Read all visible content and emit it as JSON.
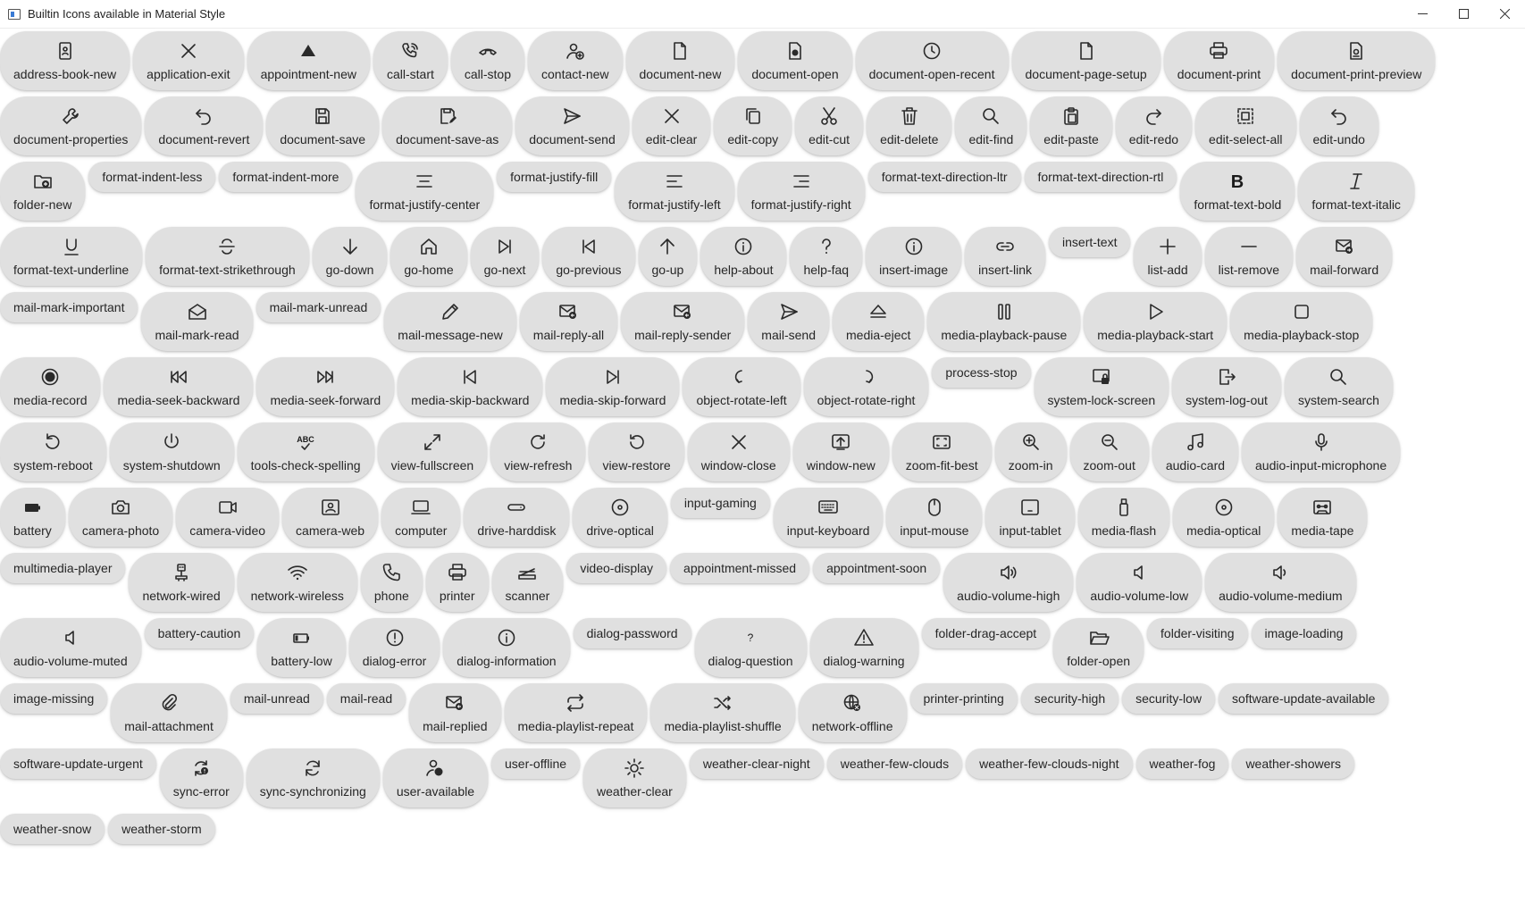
{
  "window": {
    "title": "Builtin Icons available in Material Style"
  },
  "rows": [
    [
      {
        "label": "address-book-new",
        "icon": "address-book-icon"
      },
      {
        "label": "application-exit",
        "icon": "close-icon"
      },
      {
        "label": "appointment-new",
        "icon": "triangle-icon"
      },
      {
        "label": "call-start",
        "icon": "phone-ring-icon"
      },
      {
        "label": "call-stop",
        "icon": "phone-hangup-icon"
      },
      {
        "label": "contact-new",
        "icon": "person-add-icon"
      },
      {
        "label": "document-new",
        "icon": "document-icon"
      },
      {
        "label": "document-open",
        "icon": "document-open-icon"
      },
      {
        "label": "document-open-recent",
        "icon": "clock-icon"
      },
      {
        "label": "document-page-setup",
        "icon": "document-icon"
      },
      {
        "label": "document-print",
        "icon": "printer-icon"
      },
      {
        "label": "document-print-preview",
        "icon": "document-preview-icon"
      }
    ],
    [
      {
        "label": "document-properties",
        "icon": "wrench-icon"
      },
      {
        "label": "document-revert",
        "icon": "undo-icon"
      },
      {
        "label": "document-save",
        "icon": "save-icon"
      },
      {
        "label": "document-save-as",
        "icon": "save-as-icon"
      },
      {
        "label": "document-send",
        "icon": "send-icon"
      },
      {
        "label": "edit-clear",
        "icon": "close-icon"
      },
      {
        "label": "edit-copy",
        "icon": "copy-icon"
      },
      {
        "label": "edit-cut",
        "icon": "scissors-icon"
      },
      {
        "label": "edit-delete",
        "icon": "trash-icon"
      },
      {
        "label": "edit-find",
        "icon": "search-icon"
      },
      {
        "label": "edit-paste",
        "icon": "clipboard-icon"
      },
      {
        "label": "edit-redo",
        "icon": "redo-icon"
      },
      {
        "label": "edit-select-all",
        "icon": "select-all-icon"
      },
      {
        "label": "edit-undo",
        "icon": "undo-icon"
      }
    ],
    [
      {
        "label": "folder-new",
        "icon": "folder-add-icon"
      },
      {
        "label": "format-indent-less",
        "icon": ""
      },
      {
        "label": "format-indent-more",
        "icon": ""
      },
      {
        "label": "format-justify-center",
        "icon": "align-center-icon"
      },
      {
        "label": "format-justify-fill",
        "icon": ""
      },
      {
        "label": "format-justify-left",
        "icon": "align-left-icon"
      },
      {
        "label": "format-justify-right",
        "icon": "align-right-icon"
      },
      {
        "label": "format-text-direction-ltr",
        "icon": ""
      },
      {
        "label": "format-text-direction-rtl",
        "icon": ""
      },
      {
        "label": "format-text-bold",
        "icon": "bold-icon"
      },
      {
        "label": "format-text-italic",
        "icon": "italic-icon"
      }
    ],
    [
      {
        "label": "format-text-underline",
        "icon": "underline-icon"
      },
      {
        "label": "format-text-strikethrough",
        "icon": "strikethrough-icon"
      },
      {
        "label": "go-down",
        "icon": "arrow-down-icon"
      },
      {
        "label": "go-home",
        "icon": "home-icon"
      },
      {
        "label": "go-next",
        "icon": "skip-next-icon"
      },
      {
        "label": "go-previous",
        "icon": "skip-previous-icon"
      },
      {
        "label": "go-up",
        "icon": "arrow-up-icon"
      },
      {
        "label": "help-about",
        "icon": "info-icon"
      },
      {
        "label": "help-faq",
        "icon": "question-icon"
      },
      {
        "label": "insert-image",
        "icon": "info-icon"
      },
      {
        "label": "insert-link",
        "icon": "link-icon"
      },
      {
        "label": "insert-text",
        "icon": ""
      },
      {
        "label": "list-add",
        "icon": "plus-icon"
      },
      {
        "label": "list-remove",
        "icon": "minus-icon"
      },
      {
        "label": "mail-forward",
        "icon": "mail-forward-icon"
      }
    ],
    [
      {
        "label": "mail-mark-important",
        "icon": ""
      },
      {
        "label": "mail-mark-read",
        "icon": "mail-open-icon"
      },
      {
        "label": "mail-mark-unread",
        "icon": ""
      },
      {
        "label": "mail-message-new",
        "icon": "pencil-icon"
      },
      {
        "label": "mail-reply-all",
        "icon": "mail-reply-icon"
      },
      {
        "label": "mail-reply-sender",
        "icon": "mail-reply-icon"
      },
      {
        "label": "mail-send",
        "icon": "send-icon"
      },
      {
        "label": "media-eject",
        "icon": "eject-icon"
      },
      {
        "label": "media-playback-pause",
        "icon": "pause-icon"
      },
      {
        "label": "media-playback-start",
        "icon": "play-icon"
      },
      {
        "label": "media-playback-stop",
        "icon": "stop-icon"
      }
    ],
    [
      {
        "label": "media-record",
        "icon": "record-icon"
      },
      {
        "label": "media-seek-backward",
        "icon": "rewind-icon"
      },
      {
        "label": "media-seek-forward",
        "icon": "fast-forward-icon"
      },
      {
        "label": "media-skip-backward",
        "icon": "skip-previous-icon"
      },
      {
        "label": "media-skip-forward",
        "icon": "skip-next-icon"
      },
      {
        "label": "object-rotate-left",
        "icon": "rotate-left-icon"
      },
      {
        "label": "object-rotate-right",
        "icon": "rotate-right-icon"
      },
      {
        "label": "process-stop",
        "icon": ""
      },
      {
        "label": "system-lock-screen",
        "icon": "lock-screen-icon"
      },
      {
        "label": "system-log-out",
        "icon": "logout-icon"
      },
      {
        "label": "system-search",
        "icon": "search-icon"
      }
    ],
    [
      {
        "label": "system-reboot",
        "icon": "reboot-icon"
      },
      {
        "label": "system-shutdown",
        "icon": "power-icon"
      },
      {
        "label": "tools-check-spelling",
        "icon": "spellcheck-icon"
      },
      {
        "label": "view-fullscreen",
        "icon": "fullscreen-icon"
      },
      {
        "label": "view-refresh",
        "icon": "refresh-icon"
      },
      {
        "label": "view-restore",
        "icon": "restore-icon"
      },
      {
        "label": "window-close",
        "icon": "close-icon"
      },
      {
        "label": "window-new",
        "icon": "window-new-icon"
      },
      {
        "label": "zoom-fit-best",
        "icon": "fit-screen-icon"
      },
      {
        "label": "zoom-in",
        "icon": "zoom-in-icon"
      },
      {
        "label": "zoom-out",
        "icon": "zoom-out-icon"
      },
      {
        "label": "audio-card",
        "icon": "music-note-icon"
      },
      {
        "label": "audio-input-microphone",
        "icon": "microphone-icon"
      }
    ],
    [
      {
        "label": "battery",
        "icon": "battery-icon"
      },
      {
        "label": "camera-photo",
        "icon": "camera-icon"
      },
      {
        "label": "camera-video",
        "icon": "video-camera-icon"
      },
      {
        "label": "camera-web",
        "icon": "webcam-icon"
      },
      {
        "label": "computer",
        "icon": "computer-icon"
      },
      {
        "label": "drive-harddisk",
        "icon": "harddisk-icon"
      },
      {
        "label": "drive-optical",
        "icon": "disc-icon"
      },
      {
        "label": "input-gaming",
        "icon": ""
      },
      {
        "label": "input-keyboard",
        "icon": "keyboard-icon"
      },
      {
        "label": "input-mouse",
        "icon": "mouse-icon"
      },
      {
        "label": "input-tablet",
        "icon": "tablet-icon"
      },
      {
        "label": "media-flash",
        "icon": "usb-stick-icon"
      },
      {
        "label": "media-optical",
        "icon": "disc-icon"
      },
      {
        "label": "media-tape",
        "icon": "tape-icon"
      }
    ],
    [
      {
        "label": "multimedia-player",
        "icon": ""
      },
      {
        "label": "network-wired",
        "icon": "ethernet-icon"
      },
      {
        "label": "network-wireless",
        "icon": "wifi-icon"
      },
      {
        "label": "phone",
        "icon": "phone-icon"
      },
      {
        "label": "printer",
        "icon": "printer-icon"
      },
      {
        "label": "scanner",
        "icon": "scanner-icon"
      },
      {
        "label": "video-display",
        "icon": ""
      },
      {
        "label": "appointment-missed",
        "icon": ""
      },
      {
        "label": "appointment-soon",
        "icon": ""
      },
      {
        "label": "audio-volume-high",
        "icon": "volume-high-icon"
      },
      {
        "label": "audio-volume-low",
        "icon": "volume-low-icon"
      },
      {
        "label": "audio-volume-medium",
        "icon": "volume-medium-icon"
      }
    ],
    [
      {
        "label": "audio-volume-muted",
        "icon": "volume-muted-icon"
      },
      {
        "label": "battery-caution",
        "icon": ""
      },
      {
        "label": "battery-low",
        "icon": "battery-low-icon"
      },
      {
        "label": "dialog-error",
        "icon": "error-icon"
      },
      {
        "label": "dialog-information",
        "icon": "info-icon"
      },
      {
        "label": "dialog-password",
        "icon": ""
      },
      {
        "label": "dialog-question",
        "icon": "question-small-icon"
      },
      {
        "label": "dialog-warning",
        "icon": "warning-icon"
      },
      {
        "label": "folder-drag-accept",
        "icon": ""
      },
      {
        "label": "folder-open",
        "icon": "folder-open-icon"
      },
      {
        "label": "folder-visiting",
        "icon": ""
      },
      {
        "label": "image-loading",
        "icon": ""
      }
    ],
    [
      {
        "label": "image-missing",
        "icon": ""
      },
      {
        "label": "mail-attachment",
        "icon": "paperclip-icon"
      },
      {
        "label": "mail-unread",
        "icon": ""
      },
      {
        "label": "mail-read",
        "icon": ""
      },
      {
        "label": "mail-replied",
        "icon": "mail-reply-icon"
      },
      {
        "label": "media-playlist-repeat",
        "icon": "repeat-icon"
      },
      {
        "label": "media-playlist-shuffle",
        "icon": "shuffle-icon"
      },
      {
        "label": "network-offline",
        "icon": "globe-offline-icon"
      },
      {
        "label": "printer-printing",
        "icon": ""
      },
      {
        "label": "security-high",
        "icon": ""
      },
      {
        "label": "security-low",
        "icon": ""
      },
      {
        "label": "software-update-available",
        "icon": ""
      }
    ],
    [
      {
        "label": "software-update-urgent",
        "icon": ""
      },
      {
        "label": "sync-error",
        "icon": "sync-error-icon"
      },
      {
        "label": "sync-synchronizing",
        "icon": "sync-icon"
      },
      {
        "label": "user-available",
        "icon": "user-available-icon"
      },
      {
        "label": "user-offline",
        "icon": ""
      },
      {
        "label": "weather-clear",
        "icon": "sun-icon"
      },
      {
        "label": "weather-clear-night",
        "icon": ""
      },
      {
        "label": "weather-few-clouds",
        "icon": ""
      },
      {
        "label": "weather-few-clouds-night",
        "icon": ""
      },
      {
        "label": "weather-fog",
        "icon": ""
      },
      {
        "label": "weather-showers",
        "icon": ""
      }
    ],
    [
      {
        "label": "weather-snow",
        "icon": ""
      },
      {
        "label": "weather-storm",
        "icon": ""
      }
    ]
  ]
}
